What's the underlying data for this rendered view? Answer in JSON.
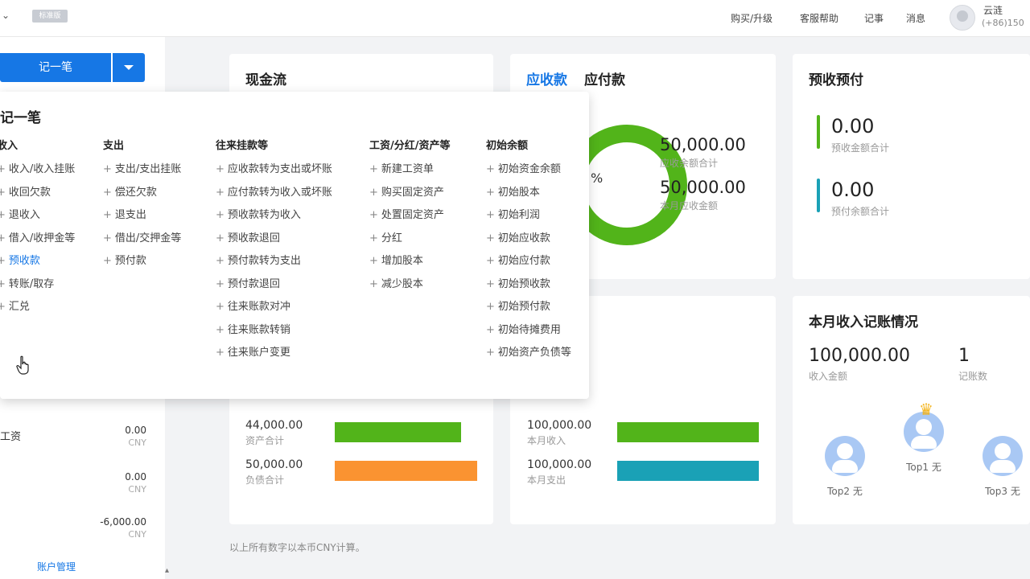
{
  "topbar": {
    "chevron": "⌄",
    "logo_badge": "标准版",
    "nav": [
      "购买/升级",
      "客服帮助",
      "记事",
      "消息"
    ],
    "user_name": "云涟",
    "user_phone": "(+86)150"
  },
  "sidebar": {
    "record_button": "记一笔",
    "accounts": [
      {
        "name": "工资",
        "value": "0.00",
        "unit": "CNY"
      },
      {
        "name": "",
        "value": "0.00",
        "unit": "CNY"
      },
      {
        "name": "",
        "value": "-6,000.00",
        "unit": "CNY"
      }
    ],
    "manage_link": "账户管理"
  },
  "cards": {
    "cashflow": {
      "title": "现金流",
      "rows": [
        {
          "value": "44,000.00",
          "label": "资产合计"
        },
        {
          "value": "50,000.00",
          "label": "负债合计"
        }
      ]
    },
    "receivable": {
      "tab_active": "应收款",
      "tab_other": "应付款",
      "donut_pct": "%",
      "stats": [
        {
          "value": "50,000.00",
          "label": "应收余额合计"
        },
        {
          "value": "50,000.00",
          "label": "本月应收金额"
        }
      ],
      "rows": [
        {
          "value": "100,000.00",
          "label": "本月收入"
        },
        {
          "value": "100,000.00",
          "label": "本月支出"
        }
      ]
    },
    "prepaid": {
      "title": "预收预付",
      "items": [
        {
          "value": "0.00",
          "label": "预收金额合计",
          "color": "#52b41a"
        },
        {
          "value": "0.00",
          "label": "预付余额合计",
          "color": "#1aa1b6"
        }
      ]
    },
    "monthly": {
      "title": "本月收入记账情况",
      "income_value": "100,000.00",
      "income_label": "收入金额",
      "count_value": "1",
      "count_label": "记账数",
      "ranks": [
        {
          "caption": "Top2 无"
        },
        {
          "caption": "Top1 无"
        },
        {
          "caption": "Top3 无"
        }
      ]
    }
  },
  "footnote": "以上所有数字以本币CNY计算。",
  "dropdown": {
    "title": "记一笔",
    "columns": [
      {
        "heading": "收入",
        "items": [
          "收入/收入挂账",
          "收回欠款",
          "退收入",
          "借入/收押金等",
          "预收款",
          "转账/取存",
          "汇兑"
        ]
      },
      {
        "heading": "支出",
        "items": [
          "支出/支出挂账",
          "偿还欠款",
          "退支出",
          "借出/交押金等",
          "预付款"
        ]
      },
      {
        "heading": "往来挂款等",
        "items": [
          "应收款转为支出或坏账",
          "应付款转为收入或坏账",
          "预收款转为收入",
          "预收款退回",
          "预付款转为支出",
          "预付款退回",
          "往来账款对冲",
          "往来账款转销",
          "往来账户变更"
        ]
      },
      {
        "heading": "工资/分红/资产等",
        "items": [
          "新建工资单",
          "购买固定资产",
          "处置固定资产",
          "分红",
          "增加股本",
          "减少股本"
        ]
      },
      {
        "heading": "初始余额",
        "items": [
          "初始资金余额",
          "初始股本",
          "初始利润",
          "初始应收款",
          "初始应付款",
          "初始预收款",
          "初始预付款",
          "初始待摊费用",
          "初始资产负债等"
        ]
      }
    ]
  },
  "colors": {
    "primary": "#1677e5",
    "green": "#52b41a",
    "orange": "#fa9331",
    "teal": "#1aa1b6"
  }
}
